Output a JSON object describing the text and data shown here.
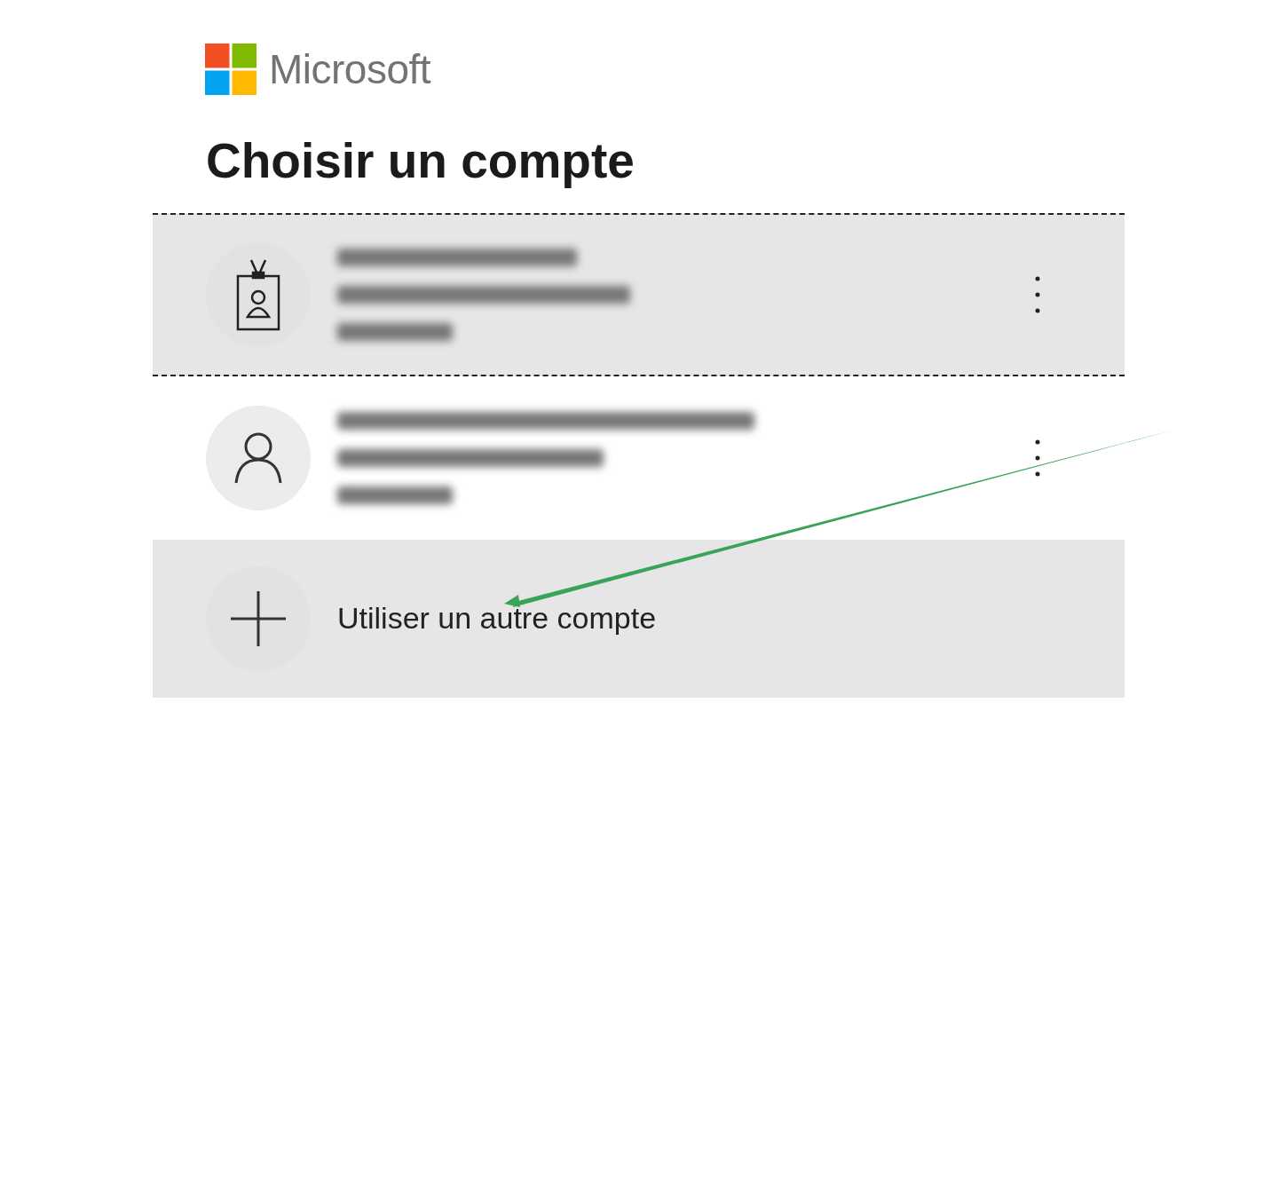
{
  "brand": {
    "name": "Microsoft"
  },
  "title": "Choisir un compte",
  "accounts": [
    {
      "kind": "badge",
      "selected": true
    },
    {
      "kind": "person",
      "selected": false
    }
  ],
  "add_account": {
    "label": "Utiliser un autre compte"
  }
}
